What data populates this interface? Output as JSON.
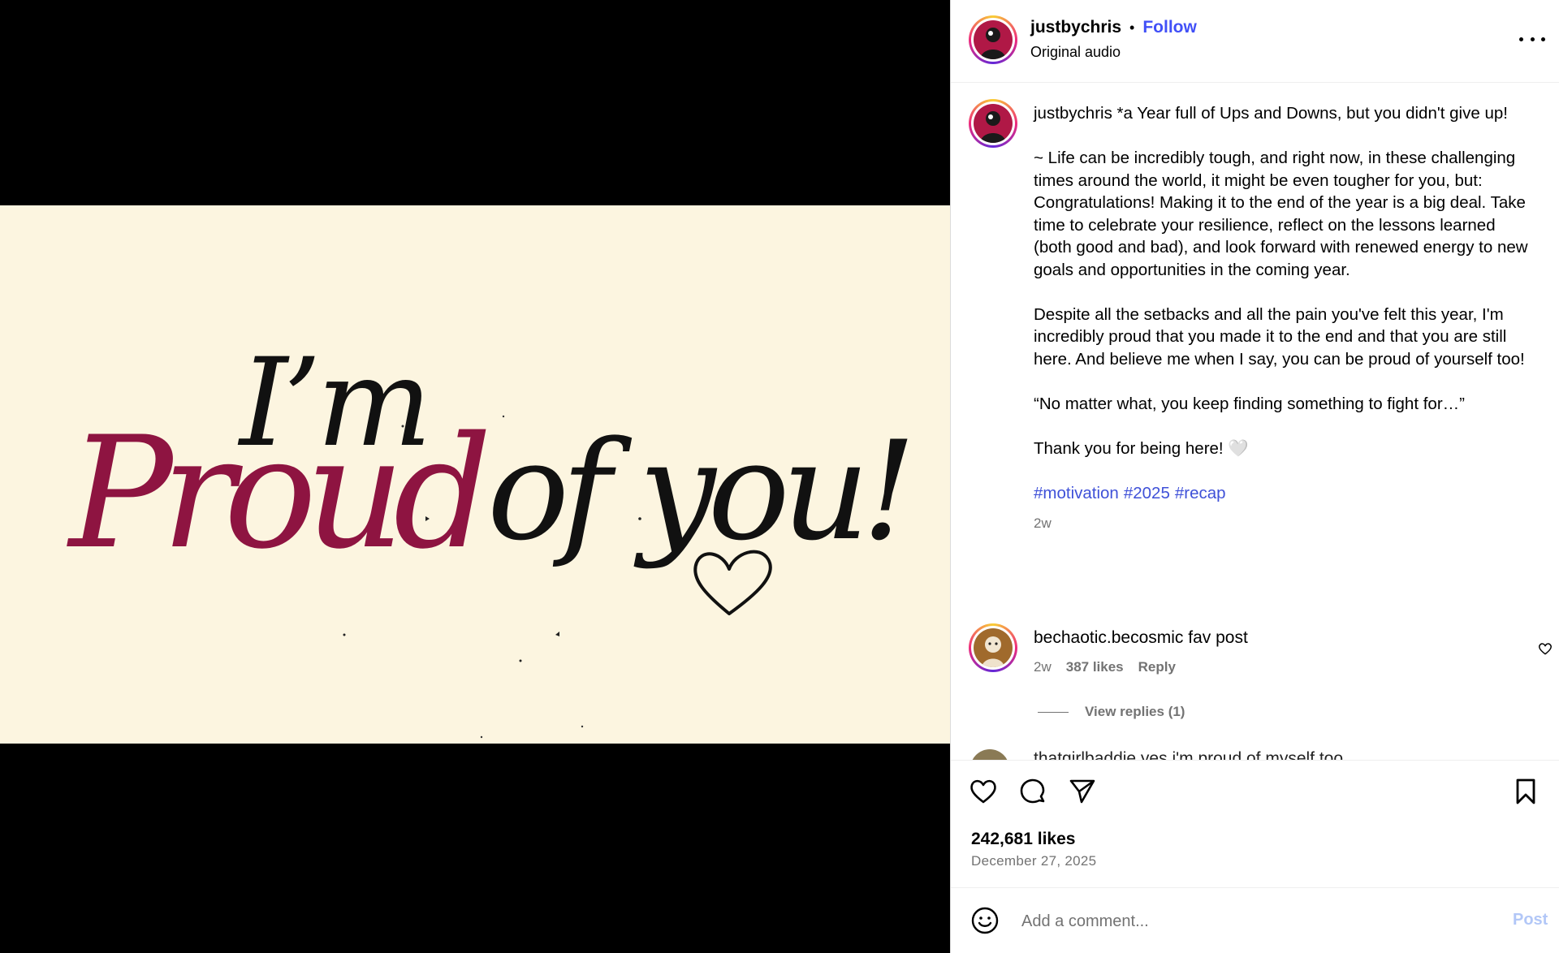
{
  "post": {
    "username": "justbychris",
    "separator": "•",
    "follow_label": "Follow",
    "audio_label": "Original audio",
    "video_text": {
      "line1": "I’m",
      "line2_accent": "Proud",
      "line2_rest": "of you!"
    },
    "accent_color": "#8e1441",
    "caption": {
      "username": "justbychris",
      "first_line": " *a Year full of Ups and Downs, but you didn't give up!",
      "paragraph1": "~ Life can be incredibly tough, and right now, in these challenging times around the world, it might be even tougher for you, but: Congratulations! Making it to the end of the year is a big deal. Take time to celebrate your resilience, reflect on the lessons learned (both good and bad), and look forward with renewed energy to new goals and opportunities in the coming year.",
      "paragraph2": "Despite all the setbacks and all the pain you've felt this year, I'm incredibly proud that you made it to the end and that you are still here. And believe me when I say, you can be proud of yourself too!",
      "paragraph3": "“No matter what, you keep finding something to fight for…”",
      "paragraph4": "Thank you for being here! 🤍",
      "hashtags": [
        "#motivation",
        "#2025",
        "#recap"
      ],
      "time": "2w"
    },
    "comments": [
      {
        "username": "bechaotic.becosmic",
        "text": " fav post",
        "time": "2w",
        "likes": "387 likes",
        "reply_label": "Reply",
        "view_replies": "View replies (1)"
      }
    ],
    "next_comment_peek": "thatgirlbaddie yes i'm proud of myself too",
    "likes": "242,681 likes",
    "date": "December 27, 2025",
    "comment_placeholder": "Add a comment...",
    "post_label": "Post"
  }
}
